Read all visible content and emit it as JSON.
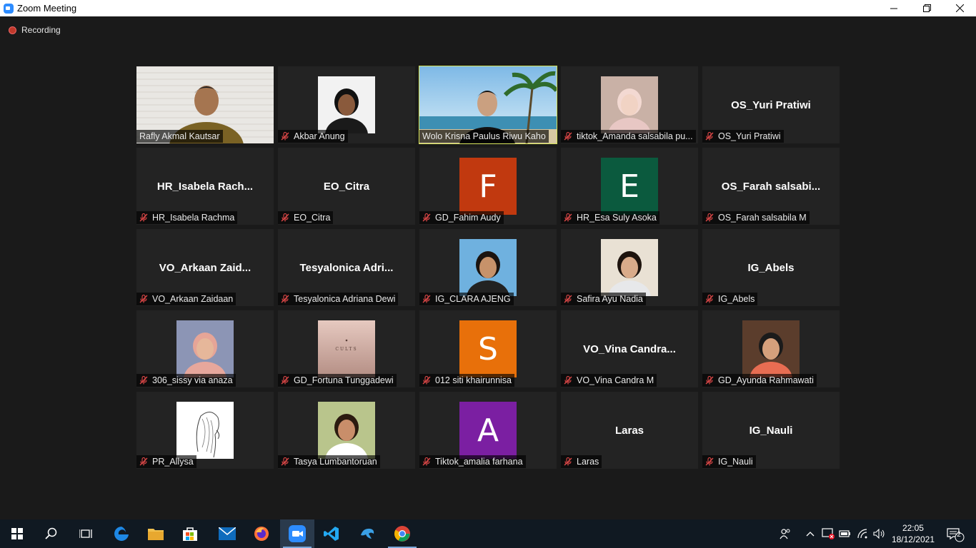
{
  "window": {
    "title": "Zoom Meeting",
    "controls": [
      "minimize",
      "maximize",
      "close"
    ]
  },
  "recording": {
    "label": "Recording"
  },
  "participants": [
    {
      "name": "Rafly Akmal Kautsar",
      "type": "video",
      "muted": false
    },
    {
      "name": "Akbar Anung",
      "type": "photo",
      "muted": true
    },
    {
      "name": "Wolo Krisna Paulus Riwu Kaho",
      "type": "video",
      "muted": false,
      "active_speaker": true
    },
    {
      "name": "tiktok_Amanda salsabila pu...",
      "type": "photo",
      "muted": true
    },
    {
      "name": "OS_Yuri Pratiwi",
      "display": "OS_Yuri Pratiwi",
      "type": "name",
      "muted": true
    },
    {
      "name": "HR_Isabela Rachma",
      "display": "HR_Isabela  Rach...",
      "type": "name",
      "muted": true
    },
    {
      "name": "EO_Citra",
      "display": "EO_Citra",
      "type": "name",
      "muted": true
    },
    {
      "name": "GD_Fahim Audy",
      "type": "letter",
      "letter": "F",
      "color": "#c1390f",
      "muted": true
    },
    {
      "name": "HR_Esa Suly Asoka",
      "type": "letter",
      "letter": "E",
      "color": "#0b5a3e",
      "muted": true
    },
    {
      "name": "OS_Farah salsabila M",
      "display": "OS_Farah  salsabi...",
      "type": "name",
      "muted": true
    },
    {
      "name": "VO_Arkaan Zaidaan",
      "display": "VO_Arkaan  Zaid...",
      "type": "name",
      "muted": true
    },
    {
      "name": "Tesyalonica Adriana Dewi",
      "display": "Tesyalonica  Adri...",
      "type": "name",
      "muted": true
    },
    {
      "name": "IG_CLARA AJENG",
      "type": "photo",
      "muted": true
    },
    {
      "name": "Safira Ayu Nadia",
      "type": "photo",
      "muted": true
    },
    {
      "name": "IG_Abels",
      "display": "IG_Abels",
      "type": "name",
      "muted": true
    },
    {
      "name": "306_sissy via anaza",
      "type": "photo",
      "muted": true
    },
    {
      "name": "GD_Fortuna Tunggadewi",
      "type": "photo",
      "muted": true,
      "photo_text": "CULTS"
    },
    {
      "name": "012 siti khairunnisa",
      "type": "letter",
      "letter": "S",
      "color": "#e8700a",
      "muted": true
    },
    {
      "name": "VO_Vina Candra M",
      "display": "VO_Vina  Candra...",
      "type": "name",
      "muted": true
    },
    {
      "name": "GD_Ayunda Rahmawati",
      "type": "photo",
      "muted": true
    },
    {
      "name": "PR_Allysa",
      "type": "photo",
      "muted": true
    },
    {
      "name": "Tasya Lumbantoruan",
      "type": "photo",
      "muted": true
    },
    {
      "name": "Tiktok_amalia farhana",
      "type": "letter",
      "letter": "A",
      "color": "#7b1fa2",
      "muted": true
    },
    {
      "name": "Laras",
      "display": "Laras",
      "type": "name",
      "muted": true
    },
    {
      "name": "IG_Nauli",
      "display": "IG_Nauli",
      "type": "name",
      "muted": true
    }
  ],
  "taskbar": {
    "apps": [
      "start",
      "search",
      "task-view",
      "edge",
      "file-explorer",
      "microsoft-store",
      "mail",
      "firefox",
      "zoom",
      "vscode",
      "migration-app",
      "chrome"
    ],
    "clock": {
      "time": "22:05",
      "date": "18/12/2021"
    },
    "notification_count": "2"
  }
}
